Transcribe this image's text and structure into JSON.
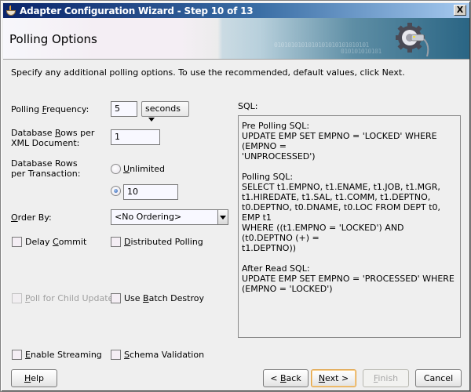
{
  "window": {
    "title": "Adapter Configuration Wizard - Step 10 of 13",
    "close_label": "X"
  },
  "banner": {
    "title": "Polling Options",
    "binary_text_1": "0101010101010101010101010101",
    "binary_text_2": "010101010101",
    "icon": "gear-plug-icon"
  },
  "instructions": "Specify any additional polling options.  To use the recommended, default values, click Next.",
  "form": {
    "polling_frequency": {
      "label_pre": "Polling ",
      "label_mnemonic": "F",
      "label_post": "requency:",
      "value": "5",
      "unit": "seconds"
    },
    "rows_per_xml": {
      "label_line1_pre": "Database ",
      "label_line1_mnemonic": "R",
      "label_line1_post": "ows per",
      "label_line2": "XML Document:",
      "value": "1"
    },
    "rows_per_transaction": {
      "label_line1": "Database Rows",
      "label_line2": "per Transaction:",
      "option_unlimited_mnemonic": "U",
      "option_unlimited_rest": "nlimited",
      "unlimited_selected": false,
      "limit_selected": true,
      "limit_value": "10"
    },
    "order_by": {
      "label_mnemonic": "O",
      "label_rest": "rder By:",
      "value": "<No Ordering>"
    },
    "checkboxes": {
      "delay_commit": {
        "pre": "Delay ",
        "mnemonic": "C",
        "post": "ommit",
        "checked": false,
        "enabled": true
      },
      "distributed_polling": {
        "pre": "",
        "mnemonic": "D",
        "post": "istributed Polling",
        "checked": false,
        "enabled": true
      },
      "poll_child_updates": {
        "pre": "",
        "mnemonic": "P",
        "post": "oll for Child Updates",
        "checked": false,
        "enabled": false
      },
      "use_batch_destroy": {
        "pre": "Use ",
        "mnemonic": "B",
        "post": "atch Destroy",
        "checked": false,
        "enabled": true
      },
      "enable_streaming": {
        "pre": "",
        "mnemonic": "E",
        "post": "nable Streaming",
        "checked": false,
        "enabled": true
      },
      "schema_validation": {
        "pre": "",
        "mnemonic": "S",
        "post": "chema Validation",
        "checked": false,
        "enabled": true
      }
    }
  },
  "sql": {
    "label": "SQL:",
    "text": "Pre Polling SQL:\nUPDATE EMP SET EMPNO = 'LOCKED' WHERE (EMPNO =\n'UNPROCESSED')\n\nPolling SQL:\nSELECT t1.EMPNO, t1.ENAME, t1.JOB, t1.MGR,\nt1.HIREDATE, t1.SAL, t1.COMM, t1.DEPTNO,\nt0.DEPTNO, t0.DNAME, t0.LOC FROM DEPT t0, EMP t1\nWHERE ((t1.EMPNO = 'LOCKED') AND (t0.DEPTNO (+) =\nt1.DEPTNO))\n\nAfter Read SQL:\nUPDATE EMP SET EMPNO = 'PROCESSED' WHERE\n(EMPNO = 'LOCKED')"
  },
  "buttons": {
    "help": {
      "mnemonic": "H",
      "rest": "elp"
    },
    "back": {
      "pre": "< ",
      "mnemonic": "B",
      "rest": "ack"
    },
    "next": {
      "mnemonic": "N",
      "rest": "ext >"
    },
    "finish": {
      "mnemonic": "F",
      "rest": "inish",
      "enabled": false
    },
    "cancel": {
      "label": "Cancel"
    }
  }
}
